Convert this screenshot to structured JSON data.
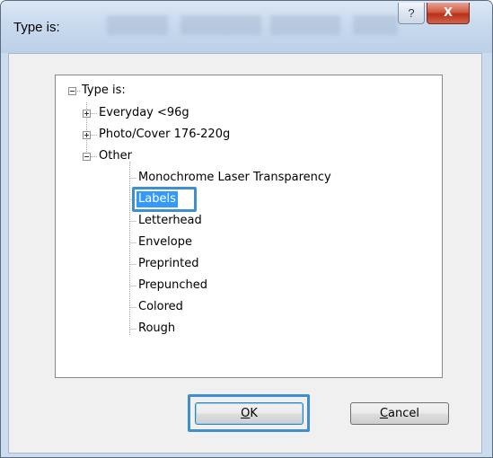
{
  "dialog": {
    "title": "Type is:",
    "help_glyph": "?",
    "close_glyph": "X"
  },
  "tree": {
    "root": "Type is:",
    "items": [
      {
        "label": "Everyday <96g",
        "expanded": false
      },
      {
        "label": "Photo/Cover 176-220g",
        "expanded": false
      },
      {
        "label": "Other",
        "expanded": true
      }
    ],
    "other_children": [
      "Monochrome Laser Transparency",
      "Labels",
      "Letterhead",
      "Envelope",
      "Preprinted",
      "Prepunched",
      "Colored",
      "Rough"
    ],
    "selected": "Labels"
  },
  "buttons": {
    "ok_label": "OK",
    "ok_mnemonic": "O",
    "ok_rest": "K",
    "cancel_label": "Cancel",
    "cancel_mnemonic": "C",
    "cancel_rest": "ancel"
  },
  "colors": {
    "selection": "#3399ff",
    "highlight_ring": "#3e8ed0",
    "close_button": "#c7432b"
  }
}
